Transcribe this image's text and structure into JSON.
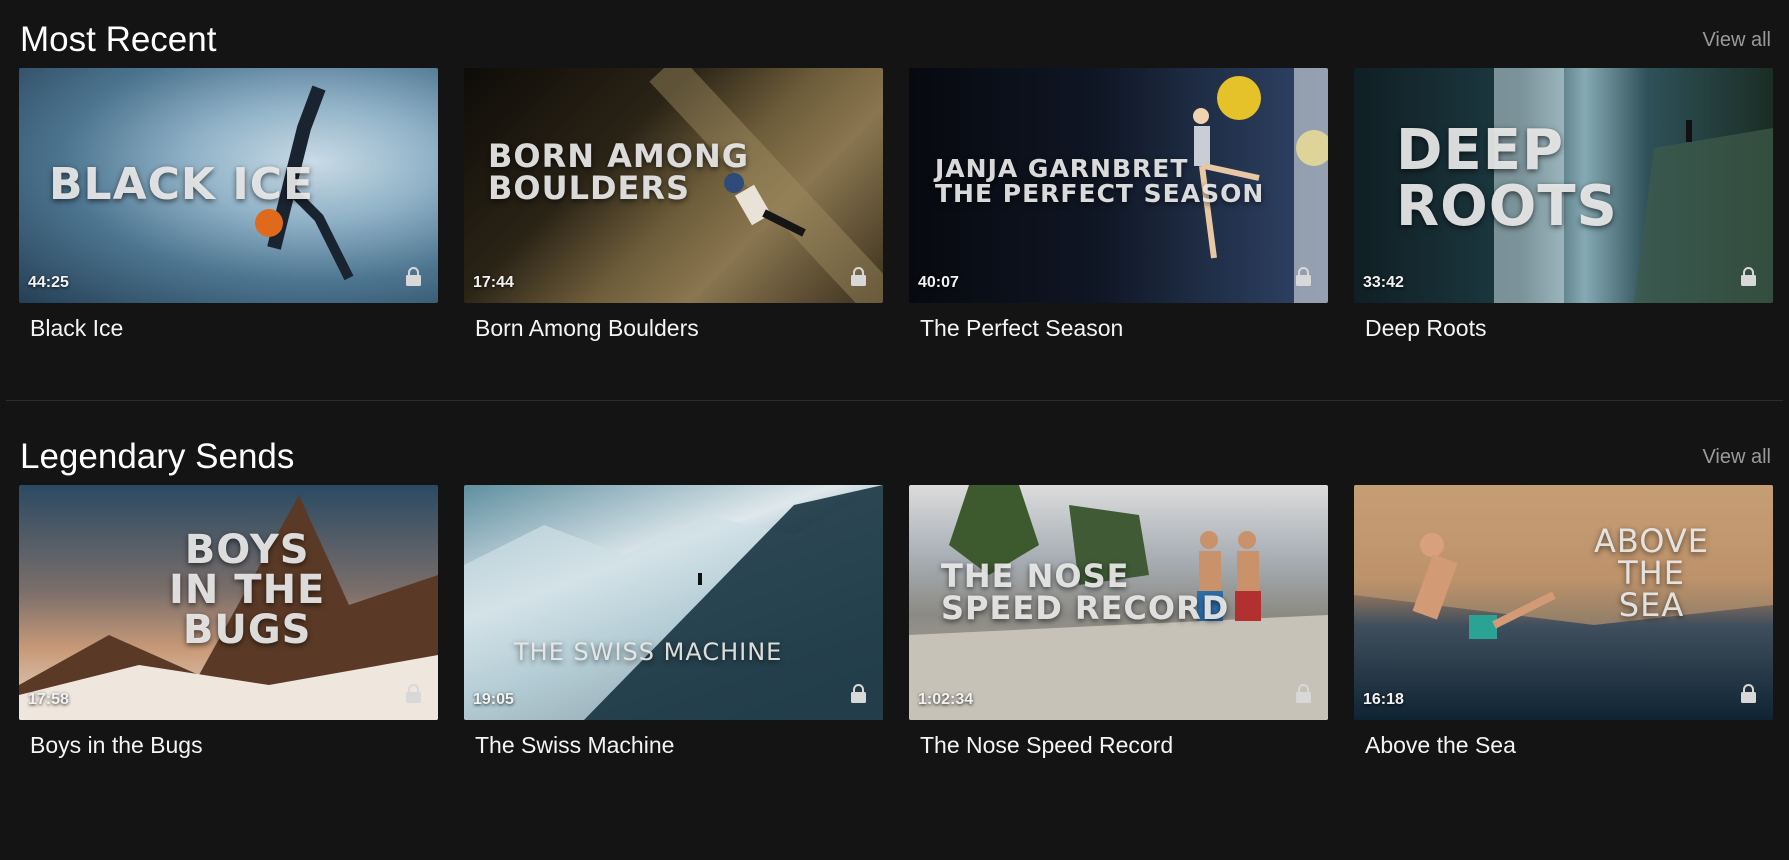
{
  "sections": [
    {
      "title": "Most Recent",
      "view_all": "View all",
      "items": [
        {
          "title": "Black Ice",
          "duration": "44:25",
          "thumb_text": "BLACK ICE",
          "locked": true
        },
        {
          "title": "Born Among Boulders",
          "duration": "17:44",
          "thumb_text": "BORN AMONG\nBOULDERS",
          "locked": true
        },
        {
          "title": "The Perfect Season",
          "duration": "40:07",
          "thumb_text": "JANJA GARNBRET\nTHE PERFECT SEASON",
          "locked": true
        },
        {
          "title": "Deep Roots",
          "duration": "33:42",
          "thumb_text": "DEEP\nROOTS",
          "locked": true
        }
      ]
    },
    {
      "title": "Legendary Sends",
      "view_all": "View all",
      "items": [
        {
          "title": "Boys in the Bugs",
          "duration": "17:58",
          "thumb_text": "BOYS\nIN THE\nBUGS",
          "locked": true
        },
        {
          "title": "The Swiss Machine",
          "duration": "19:05",
          "thumb_text": "THE SWISS MACHINE",
          "locked": true
        },
        {
          "title": "The Nose Speed Record",
          "duration": "1:02:34",
          "thumb_text": "THE NOSE\nSPEED RECORD",
          "locked": true
        },
        {
          "title": "Above the Sea",
          "duration": "16:18",
          "thumb_text": "ABOVE\nTHE\nSEA",
          "locked": true
        }
      ]
    }
  ],
  "icons": {
    "lock": "lock-icon"
  },
  "colors": {
    "background": "#141414",
    "text": "#ffffff",
    "muted": "#9a9a9a",
    "divider": "#2c2c2c"
  }
}
